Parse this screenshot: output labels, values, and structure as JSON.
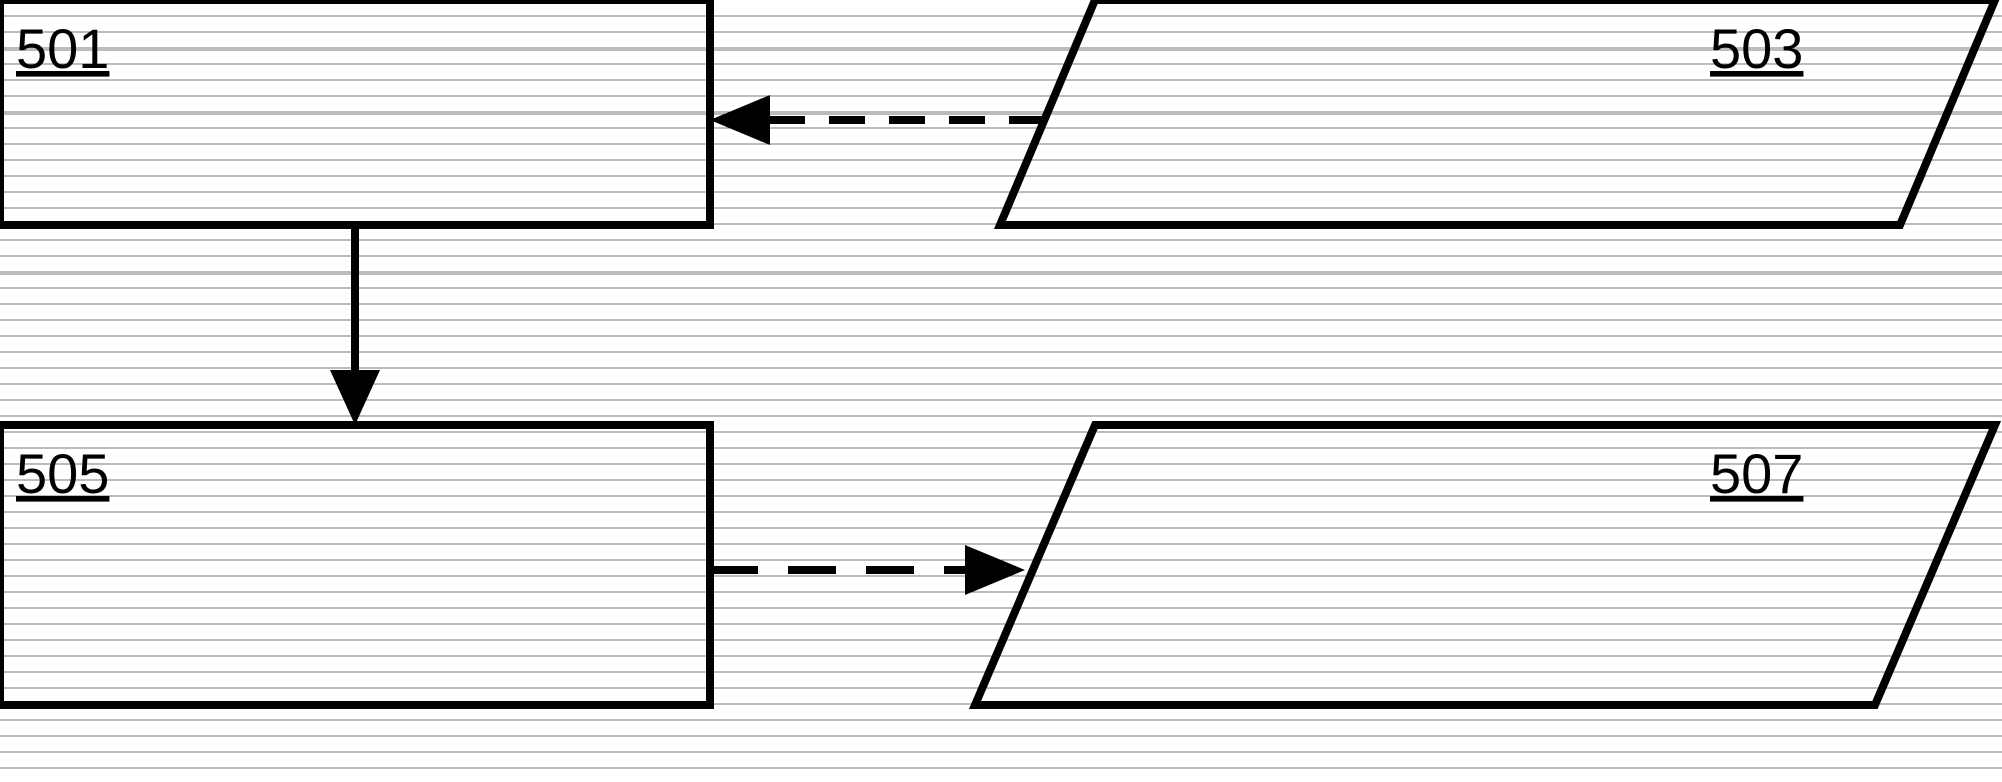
{
  "diagram": {
    "blocks": {
      "top_left_rect": {
        "label": "501"
      },
      "top_right_para": {
        "label": "503"
      },
      "bottom_left_rect": {
        "label": "505"
      },
      "bottom_right_para": {
        "label": "507"
      }
    }
  }
}
